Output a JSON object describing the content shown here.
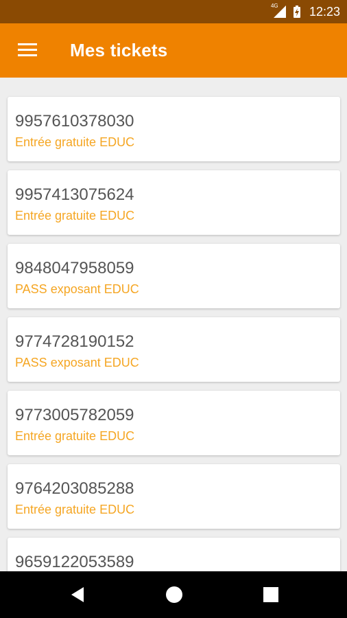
{
  "status_bar": {
    "network": "4G",
    "time": "12:23",
    "icons": [
      "signal-icon",
      "battery-icon"
    ]
  },
  "app_bar": {
    "menu_icon": "hamburger-menu-icon",
    "title": "Mes tickets"
  },
  "tickets": [
    {
      "number": "9957610378030",
      "type": "Entrée gratuite EDUC"
    },
    {
      "number": "9957413075624",
      "type": "Entrée gratuite EDUC"
    },
    {
      "number": "9848047958059",
      "type": "PASS exposant EDUC"
    },
    {
      "number": "9774728190152",
      "type": "PASS exposant EDUC"
    },
    {
      "number": "9773005782059",
      "type": "Entrée gratuite EDUC"
    },
    {
      "number": "9764203085288",
      "type": "Entrée gratuite EDUC"
    },
    {
      "number": "9659122053589",
      "type": ""
    }
  ],
  "nav_bar": {
    "icons": [
      "back-icon",
      "home-icon",
      "recents-icon"
    ]
  },
  "colors": {
    "status_bar": "#8a4a03",
    "app_bar": "#ef8200",
    "ticket_type": "#f5a623",
    "background": "#eeeeee"
  }
}
